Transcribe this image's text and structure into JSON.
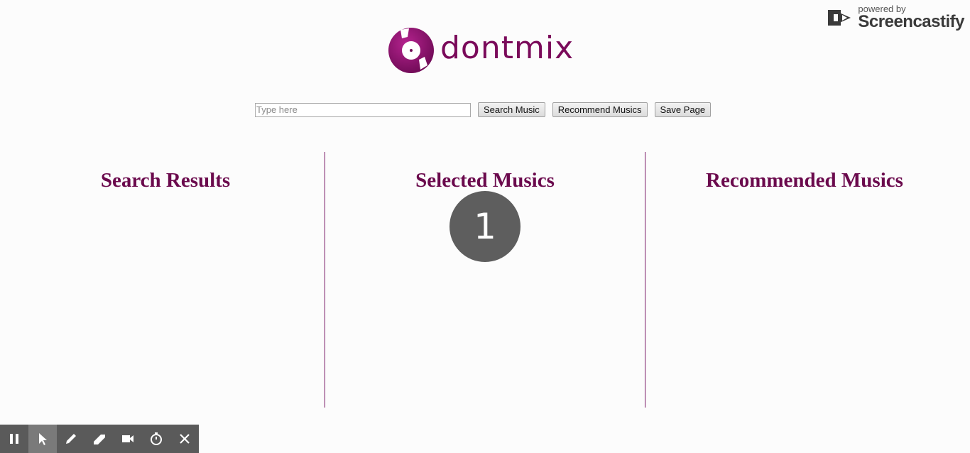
{
  "watermark": {
    "powered_by": "powered by",
    "brand": "Screencastify"
  },
  "logo": {
    "text": "dontmix",
    "color": "#7a0a5a"
  },
  "search": {
    "placeholder": "Type here",
    "value": "",
    "search_button": "Search Music",
    "recommend_button": "Recommend Musics",
    "save_button": "Save Page"
  },
  "columns": {
    "search_results": "Search Results",
    "selected_musics": "Selected Musics",
    "recommended_musics": "Recommended Musics",
    "title_color": "#6b0a4d"
  },
  "click_indicator": {
    "count": "1"
  },
  "toolbar": {
    "tools": [
      {
        "icon": "pause-icon"
      },
      {
        "icon": "cursor-icon",
        "active": true
      },
      {
        "icon": "pen-icon"
      },
      {
        "icon": "eraser-icon"
      },
      {
        "icon": "camera-icon"
      },
      {
        "icon": "timer-icon"
      },
      {
        "icon": "close-icon"
      }
    ]
  }
}
